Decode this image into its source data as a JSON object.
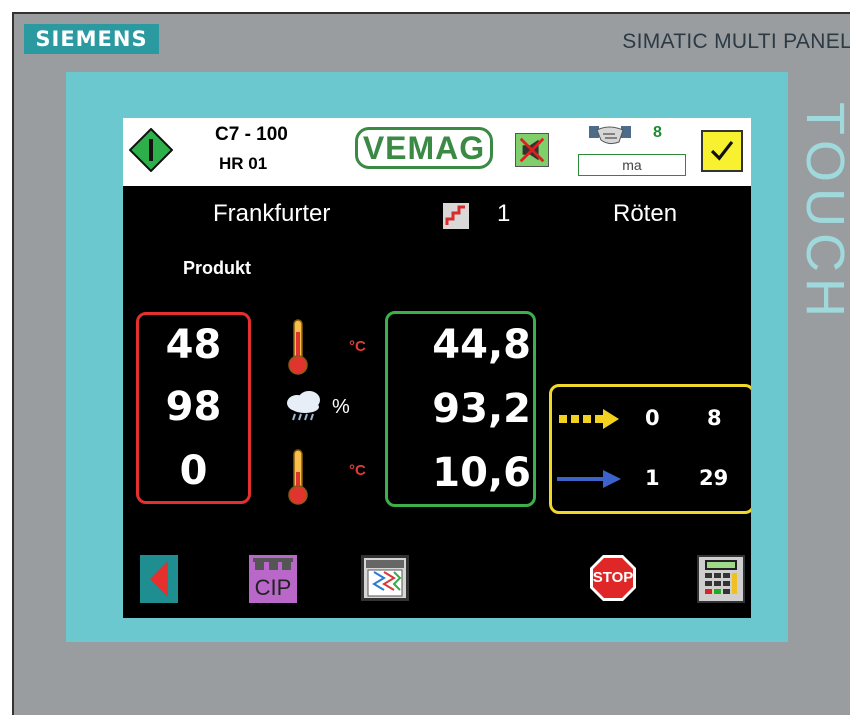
{
  "device": {
    "brand": "SIEMENS",
    "model": "SIMATIC MULTI PANEL",
    "side_label": "TOUCH"
  },
  "header": {
    "machine_code": "C7 - 100",
    "unit_id": "HR 01",
    "logo_text": "VEMAG",
    "operator_count": "8",
    "operator_field": "ma"
  },
  "status_row": {
    "product": "Frankfurter",
    "step": "1",
    "process": "Röten"
  },
  "main": {
    "produkt_label": "Produkt",
    "setpoints": [
      "48",
      "98",
      "0"
    ],
    "actuals": [
      "44,8",
      "93,2",
      "10,6"
    ],
    "unit_celsius": "°C",
    "unit_percent": "%",
    "counters": [
      {
        "arrow": "dashed-yellow-arrow-icon",
        "left": "0",
        "right": "8"
      },
      {
        "arrow": "blue-arrow-icon",
        "left": "1",
        "right": "29"
      }
    ]
  },
  "toolbar": {
    "cip_label": "CIP",
    "stop_label": "STOP"
  },
  "colors": {
    "bezel": "#6cc8cf",
    "setpoint_box": "#e5302d",
    "actual_box": "#3db04a",
    "counter_box": "#efd82a",
    "vemag_green": "#3a8a44"
  }
}
